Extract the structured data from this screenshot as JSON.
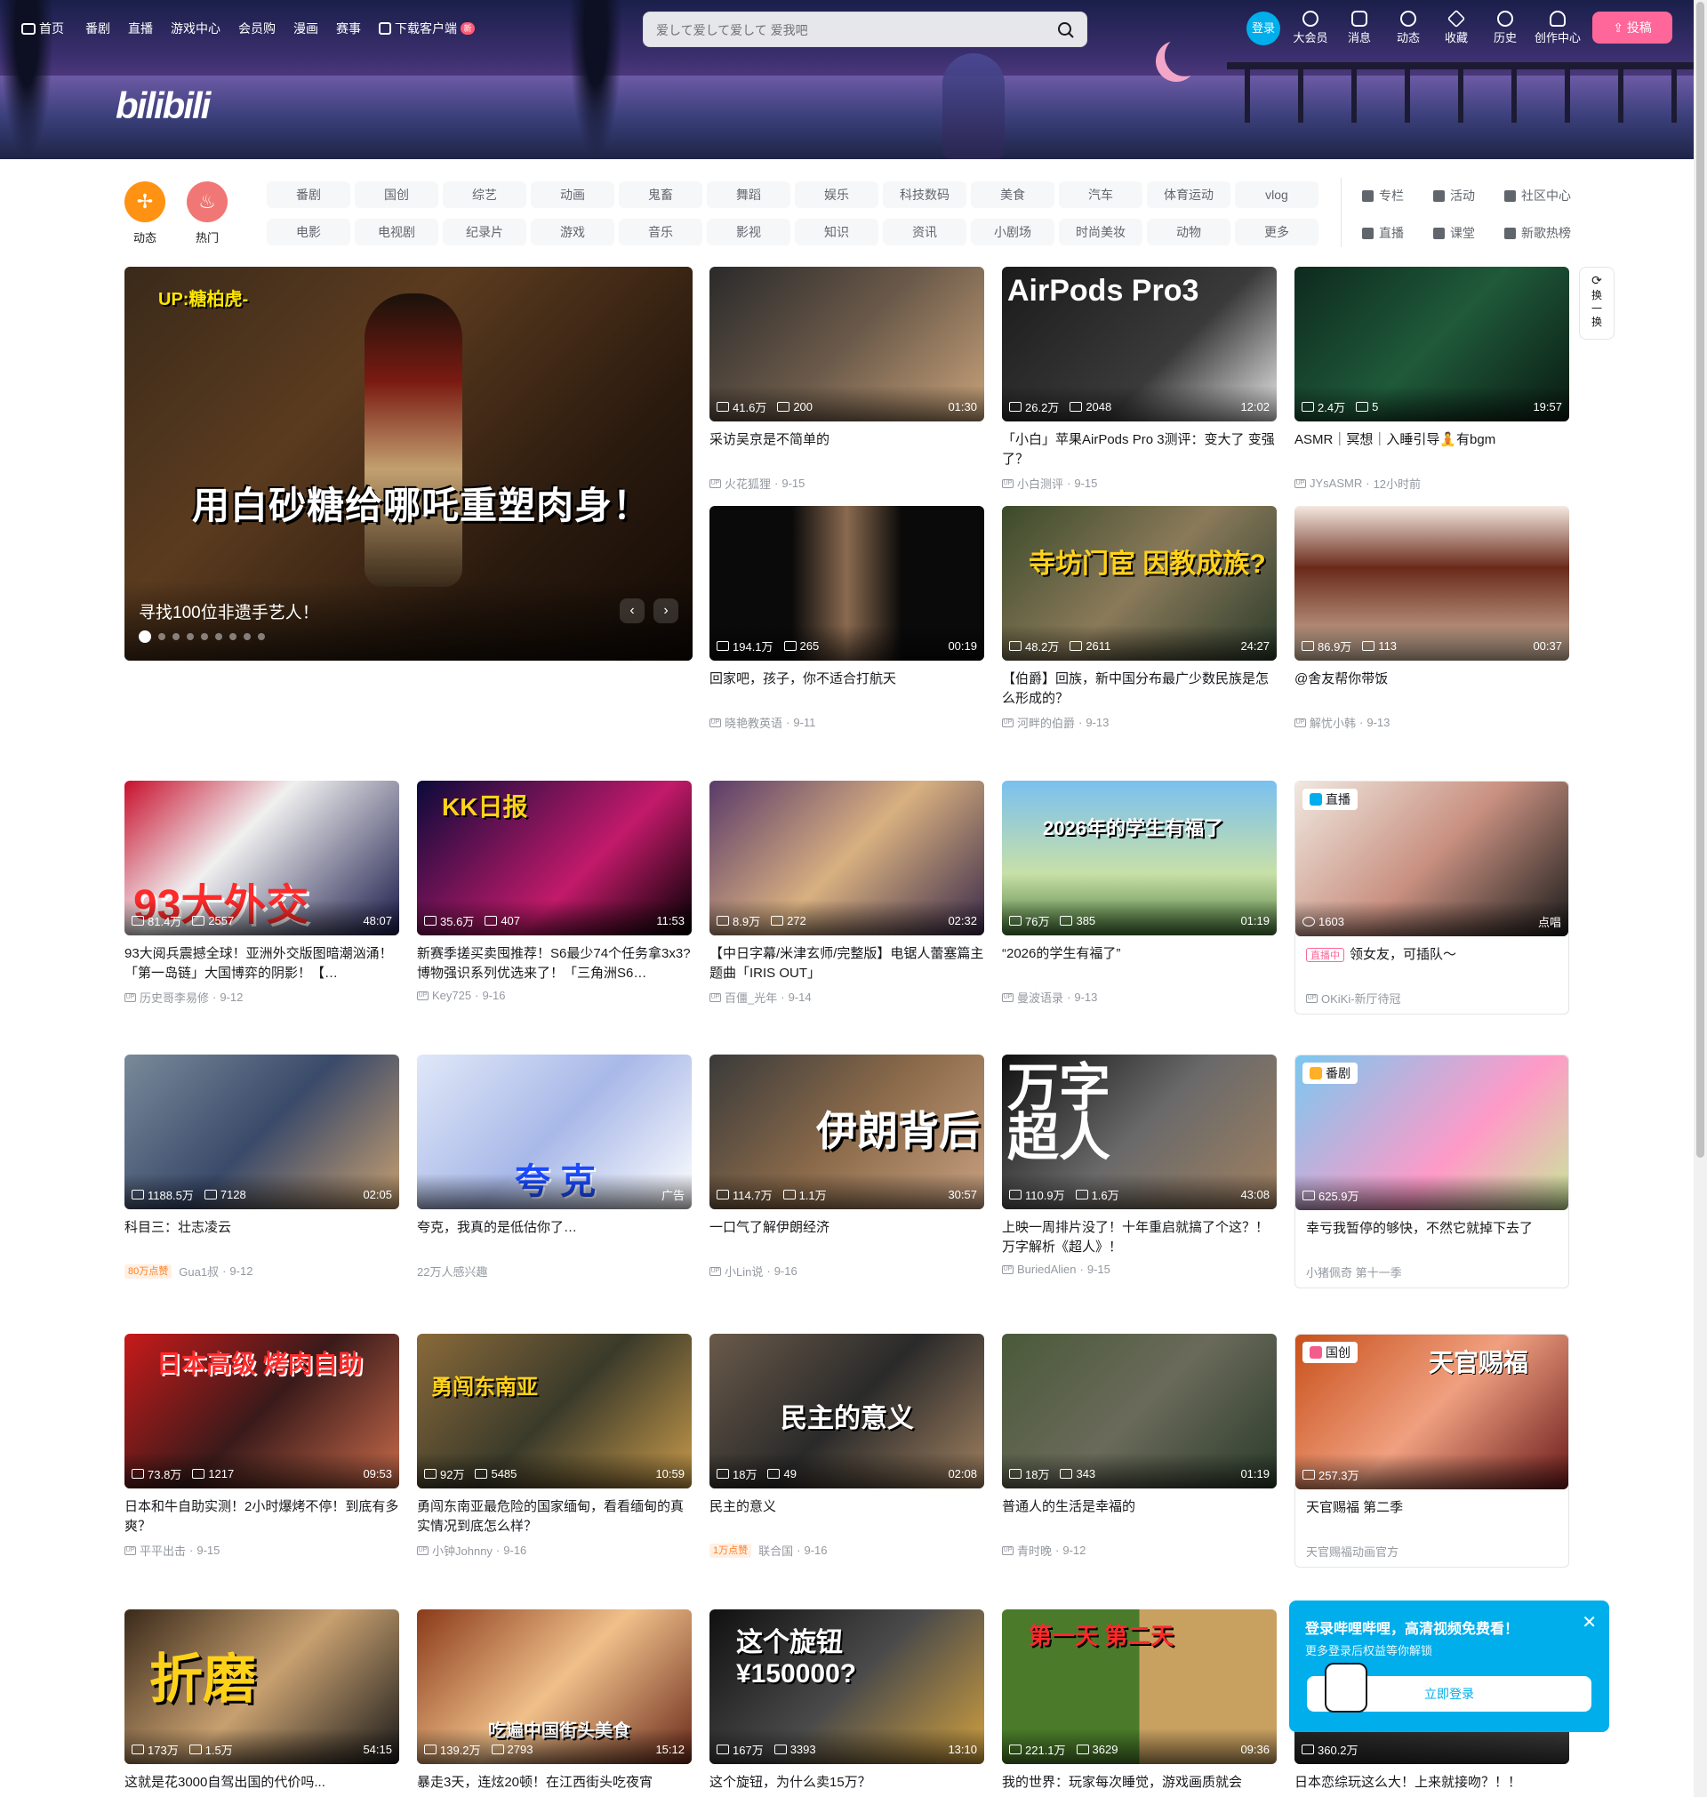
{
  "nav": {
    "left": [
      {
        "label": "首页",
        "icon": "tv-icon"
      },
      {
        "label": "番剧"
      },
      {
        "label": "直播"
      },
      {
        "label": "游戏中心"
      },
      {
        "label": "会员购"
      },
      {
        "label": "漫画"
      },
      {
        "label": "赛事"
      },
      {
        "label": "下载客户端",
        "icon": "download-icon",
        "badge": "新"
      }
    ],
    "search_placeholder": "爱して爱して爱して 爱我吧",
    "login": "登录",
    "right": [
      {
        "label": "大会员",
        "icon": "vip-icon"
      },
      {
        "label": "消息",
        "icon": "mail-icon"
      },
      {
        "label": "动态",
        "icon": "feed-icon"
      },
      {
        "label": "收藏",
        "icon": "star-icon"
      },
      {
        "label": "历史",
        "icon": "history-icon"
      },
      {
        "label": "创作中心",
        "icon": "bulb-icon"
      }
    ],
    "upload": "投稿"
  },
  "brand": {
    "logo": "bilibili",
    "accent": "#00aeec",
    "pink": "#ff6699"
  },
  "channels": {
    "circles": [
      {
        "label": "动态",
        "color": "#ff9212"
      },
      {
        "label": "热门",
        "color": "#f07775"
      }
    ],
    "row1": [
      "番剧",
      "国创",
      "综艺",
      "动画",
      "鬼畜",
      "舞蹈",
      "娱乐",
      "科技数码",
      "美食",
      "汽车",
      "体育运动",
      "vlog"
    ],
    "row2": [
      "电影",
      "电视剧",
      "纪录片",
      "游戏",
      "音乐",
      "影视",
      "知识",
      "资讯",
      "小剧场",
      "时尚美妆",
      "动物",
      "更多"
    ],
    "quick": [
      {
        "label": "专栏"
      },
      {
        "label": "活动"
      },
      {
        "label": "社区中心"
      },
      {
        "label": "直播"
      },
      {
        "label": "课堂"
      },
      {
        "label": "新歌热榜"
      }
    ]
  },
  "carousel": {
    "up_text": "UP:糖柏虎-",
    "big_text": "用白砂糖给哪吒重塑肉身！",
    "caption": "寻找100位非遗手艺人！",
    "dots": 9,
    "active": 0
  },
  "refresh_label": "换一换",
  "cards": [
    {
      "title": "采访吴京是不简单的",
      "views": "41.6万",
      "danmaku": "200",
      "duration": "01:30",
      "author": "火花狐狸",
      "date": "9-15"
    },
    {
      "title": "「小白」苹果AirPods Pro 3测评：变大了 变强了？",
      "views": "26.2万",
      "danmaku": "2048",
      "duration": "12:02",
      "author": "小白测评",
      "date": "9-15",
      "thumb_text": "AirPods Pro3"
    },
    {
      "title": "ASMR｜冥想｜入睡引导🧘有bgm",
      "views": "2.4万",
      "danmaku": "5",
      "duration": "19:57",
      "author": "JYsASMR",
      "date": "12小时前"
    },
    {
      "title": "回家吧，孩子，你不适合打航天",
      "views": "194.1万",
      "danmaku": "265",
      "duration": "00:19",
      "author": "晓艳教英语",
      "date": "9-11"
    },
    {
      "title": "【伯爵】回族，新中国分布最广少数民族是怎么形成的？",
      "views": "48.2万",
      "danmaku": "2611",
      "duration": "24:27",
      "author": "河畔的伯爵",
      "date": "9-13",
      "thumb_text": "寺坊门宦 因教成族?"
    },
    {
      "title": "@舍友帮你带饭",
      "views": "86.9万",
      "danmaku": "113",
      "duration": "00:37",
      "author": "解忧小韩",
      "date": "9-13"
    },
    {
      "title": "93大阅兵震撼全球！亚洲外交版图暗潮汹涌！「第一岛链」大国博弈的阴影！【…",
      "views": "81.4万",
      "danmaku": "2557",
      "duration": "48:07",
      "author": "历史哥李易修",
      "date": "9-12",
      "thumb_text": "93大外交"
    },
    {
      "title": "新赛季搓买卖囤推荐！S6最少74个任务拿3x3?博物强识系列优选来了！「三角洲S6…",
      "views": "35.6万",
      "danmaku": "407",
      "duration": "11:53",
      "author": "Key725",
      "date": "9-16",
      "thumb_text": "KK日报"
    },
    {
      "title": "【中日字幕/米津玄师/完整版】电锯人蕾塞篇主题曲「IRIS OUT」",
      "views": "8.9万",
      "danmaku": "272",
      "duration": "02:32",
      "author": "百僵_光年",
      "date": "9-14"
    },
    {
      "title": "“2026的学生有福了”",
      "views": "76万",
      "danmaku": "385",
      "duration": "01:19",
      "author": "曼波语录",
      "date": "9-13",
      "thumb_text": "2026年的学生有福了"
    },
    {
      "title": "领女友，可插队～",
      "views": "1603",
      "duration": "点唱",
      "author": "OKiKi-新厅待冠",
      "live": "直播中",
      "tag": "直播"
    },
    {
      "title": "科目三：壮志凌云",
      "views": "1188.5万",
      "danmaku": "7128",
      "duration": "02:05",
      "author": "Gua1叔",
      "date": "9-12",
      "hot": "80万点赞"
    },
    {
      "title": "夸克，我真的是低估你了…",
      "duration": "广告",
      "author": "22万人感兴趣",
      "thumb_text": "夸 克"
    },
    {
      "title": "一口气了解伊朗经济",
      "views": "114.7万",
      "danmaku": "1.1万",
      "duration": "30:57",
      "author": "小Lin说",
      "date": "9-16",
      "thumb_text": "伊朗背后"
    },
    {
      "title": "上映一周排片没了！十年重启就搞了个这？！万字解析《超人》！",
      "views": "110.9万",
      "danmaku": "1.6万",
      "duration": "43:08",
      "author": "BuriedAlien",
      "date": "9-15",
      "thumb_text": "万字超人"
    },
    {
      "title": "幸亏我暂停的够快，不然它就掉下去了",
      "views": "625.9万",
      "author": "小猪佩奇 第十一季",
      "tag": "番剧"
    },
    {
      "title": "日本和牛自助实测！2小时爆烤不停！到底有多爽？",
      "views": "73.8万",
      "danmaku": "1217",
      "duration": "09:53",
      "author": "平平出击",
      "date": "9-15",
      "thumb_text": "日本高级 烤肉自助"
    },
    {
      "title": "勇闯东南亚最危险的国家缅甸，看看缅甸的真实情况到底怎么样？",
      "views": "92万",
      "danmaku": "5485",
      "duration": "10:59",
      "author": "小钟Johnny",
      "date": "9-16",
      "thumb_text": "勇闯东南亚"
    },
    {
      "title": "民主的意义",
      "views": "18万",
      "danmaku": "49",
      "duration": "02:08",
      "author": "联合国",
      "date": "9-16",
      "hot": "1万点赞",
      "thumb_text": "民主的意义"
    },
    {
      "title": "普通人的生活是幸福的",
      "views": "18万",
      "danmaku": "343",
      "duration": "01:19",
      "author": "青时晚",
      "date": "9-12"
    },
    {
      "title": "天官赐福 第二季",
      "views": "257.3万",
      "author": "天官赐福动画官方",
      "tag": "国创",
      "thumb_text": "天官赐福"
    },
    {
      "title": "这就是花3000自驾出国的代价吗...",
      "views": "173万",
      "danmaku": "1.5万",
      "duration": "54:15",
      "thumb_text": "折磨"
    },
    {
      "title": "暴走3天，连炫20顿！在江西街头吃夜宵",
      "views": "139.2万",
      "danmaku": "2793",
      "duration": "15:12",
      "thumb_text": "吃遍中国街头美食"
    },
    {
      "title": "这个旋钮，为什么卖15万？",
      "views": "167万",
      "danmaku": "3393",
      "duration": "13:10",
      "thumb_text": "这个旋钮 ¥150000?"
    },
    {
      "title": "我的世界：玩家每次睡觉，游戏画质就会",
      "views": "221.1万",
      "danmaku": "3629",
      "duration": "09:36",
      "thumb_text": "第一天 第二天"
    },
    {
      "title": "日本恋综玩这么大！上来就接吻？！！",
      "views": "360.2万"
    }
  ],
  "popup": {
    "title": "登录哔哩哔哩，高清视频免费看！",
    "subtitle": "更多登录后权益等你解锁",
    "button": "立即登录"
  }
}
